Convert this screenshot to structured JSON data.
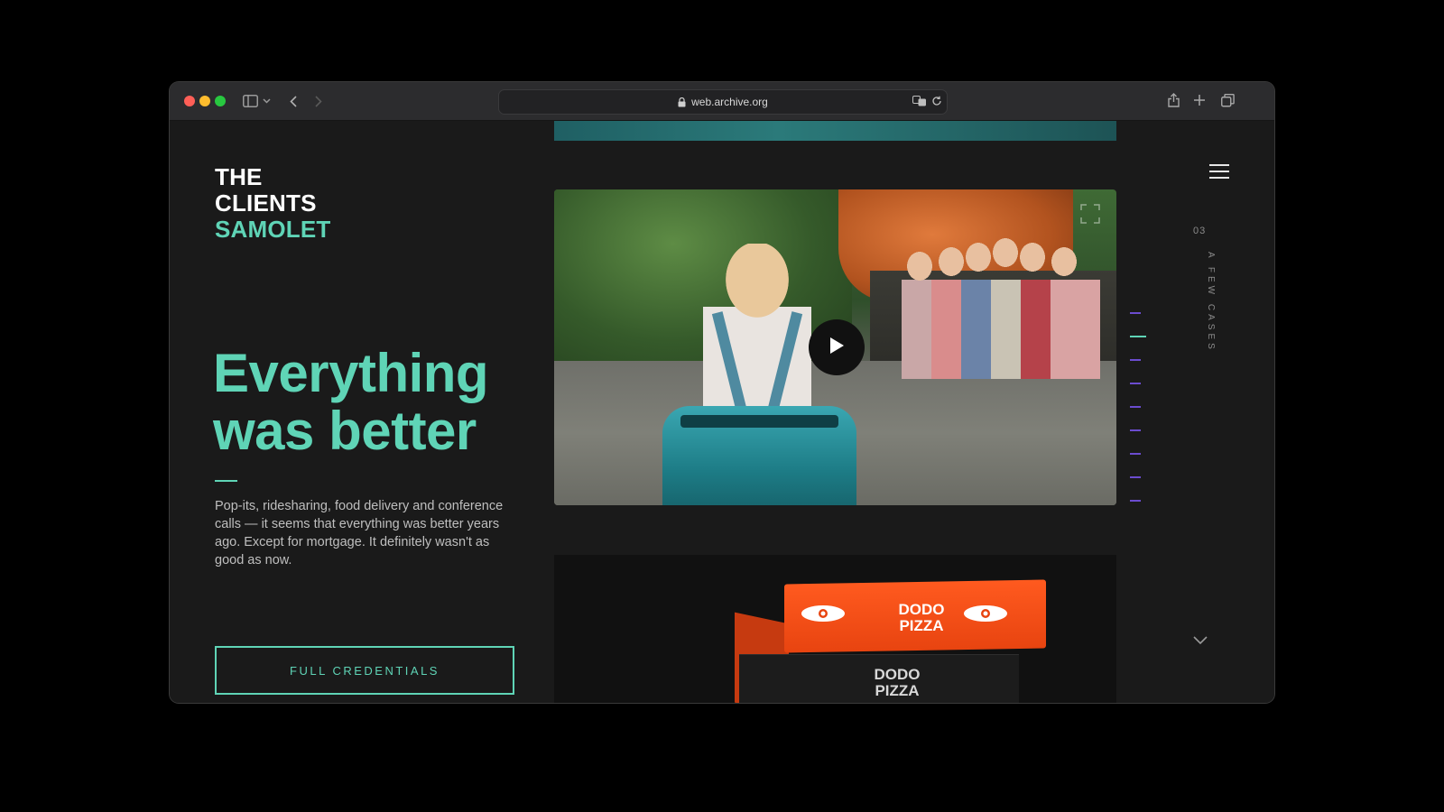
{
  "browser": {
    "url": "web.archive.org",
    "traffic_lights": [
      "close",
      "minimize",
      "zoom"
    ],
    "icons": [
      "sidebar-icon",
      "chevron-down-icon",
      "back-icon",
      "forward-icon",
      "lock-icon",
      "translate-icon",
      "reload-icon",
      "share-icon",
      "new-tab-icon",
      "tabs-overview-icon"
    ]
  },
  "header": {
    "logo_line1": "THE",
    "logo_line2": "CLIENTS",
    "logo_line3": "SAMOLET"
  },
  "hero": {
    "headline": "Everything was better",
    "description": "Pop-its, ridesharing, food delivery and conference calls — it seems that everything was better years ago. Except for mortgage. It definitely wasn't as good as now.",
    "cta_label": "FULL CREDENTIALS"
  },
  "section": {
    "number": "03",
    "label": "A FEW CASES",
    "nav_count": 9,
    "active_index": 1
  },
  "cases": {
    "video_icon": "play-icon",
    "brand_top": "DODO\nPIZZA",
    "brand_bottom": "DODO\nPIZZA"
  },
  "colors": {
    "accent": "#5fd4b6",
    "background": "#1a1a1a",
    "nav_inactive": "#6b4ccf",
    "pizza_orange": "#ff5a1f"
  }
}
